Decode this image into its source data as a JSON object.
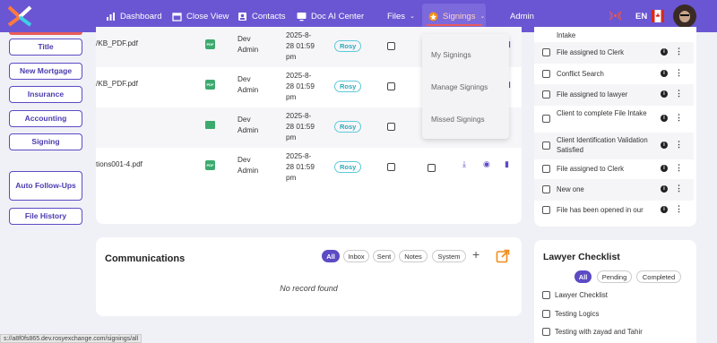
{
  "nav": {
    "dashboard": "Dashboard",
    "close_view": "Close View",
    "contacts": "Contacts",
    "doc_ai": "Doc AI Center",
    "files": "Files",
    "signings": "Signings",
    "admin": "Admin",
    "lang": "EN"
  },
  "sidebar": {
    "items": [
      "Title",
      "New Mortgage",
      "Insurance",
      "Accounting",
      "Signing"
    ],
    "auto_followups": "Auto Follow-Ups",
    "file_history": "File History"
  },
  "docs": {
    "rows": [
      {
        "name": "/KB_PDF.pdf",
        "author_1": "Dev",
        "author_2": "Admin",
        "date_1": "2025-8-",
        "date_2": "28 01:59",
        "date_3": "pm",
        "tag": "Rosy",
        "type": "pdf"
      },
      {
        "name": "/KB_PDF.pdf",
        "author_1": "Dev",
        "author_2": "Admin",
        "date_1": "2025-8-",
        "date_2": "28 01:59",
        "date_3": "pm",
        "tag": "Rosy",
        "type": "pdf"
      },
      {
        "name": "",
        "author_1": "Dev",
        "author_2": "Admin",
        "date_1": "2025-8-",
        "date_2": "28 01:59",
        "date_3": "pm",
        "tag": "Rosy",
        "type": "image"
      },
      {
        "name": "tions001-4.pdf",
        "author_1": "Dev",
        "author_2": "Admin",
        "date_1": "2025-8-",
        "date_2": "28 01:59",
        "date_3": "pm",
        "tag": "Rosy",
        "type": "pdf"
      }
    ],
    "pdf_icon_text": "PDF"
  },
  "signings_menu": {
    "items": [
      "My Signings",
      "Manage Signings",
      "Missed Signings"
    ]
  },
  "communications": {
    "title": "Communications",
    "filters": [
      "All",
      "Inbox",
      "Sent",
      "Notes",
      "System"
    ],
    "empty": "No record found"
  },
  "tasks": {
    "items": [
      "Intake",
      "File assigned to Clerk",
      "Conflict Search",
      "File assigned to lawyer",
      "Client to complete File Intake",
      "Client Identification Validation Satisfied",
      "File assigned to Clerk",
      "New one",
      "File has been opened in our"
    ]
  },
  "lawyer_checklist": {
    "title": "Lawyer Checklist",
    "filters": [
      "All",
      "Pending",
      "Completed"
    ],
    "items": [
      "Lawyer Checklist",
      "Testing Logics",
      "Testing with zayad and Tahir"
    ]
  },
  "status_url": "s://a8f0fs865.dev.rosyexchange.com/signings/all",
  "colors": {
    "brand": "#6a56d2",
    "accent": "#5b4bc4",
    "tag": "#2fa7b8",
    "pdf": "#3caa6e",
    "orange": "#f28c1a"
  }
}
